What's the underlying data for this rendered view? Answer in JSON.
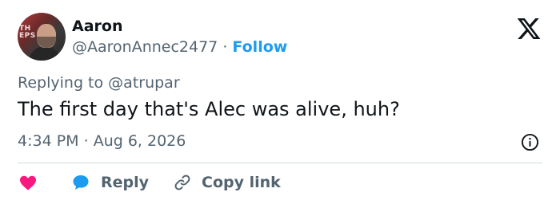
{
  "author": {
    "name": "Aaron",
    "handle": "@AaronAnnec2477",
    "separator": "·",
    "follow_label": "Follow",
    "avatar_sign_text": "TH\nEPS"
  },
  "brand_icon": "x-logo-icon",
  "replying_to": {
    "prefix": "Replying to",
    "user": "@atrupar"
  },
  "tweet": {
    "text": "The first day that's Alec was alive, huh?"
  },
  "timestamp": {
    "time": "4:34 PM",
    "separator": "·",
    "date": "Aug 6, 2026"
  },
  "actions": {
    "like_icon": "heart-icon",
    "reply_icon": "comment-bubble-icon",
    "reply_label": "Reply",
    "copy_link_icon": "link-icon",
    "copy_link_label": "Copy link"
  },
  "colors": {
    "accent": "#1d9bf0",
    "heart": "#f91880",
    "text_primary": "#0f1419",
    "text_secondary": "#536471",
    "divider": "#cfd9de"
  }
}
